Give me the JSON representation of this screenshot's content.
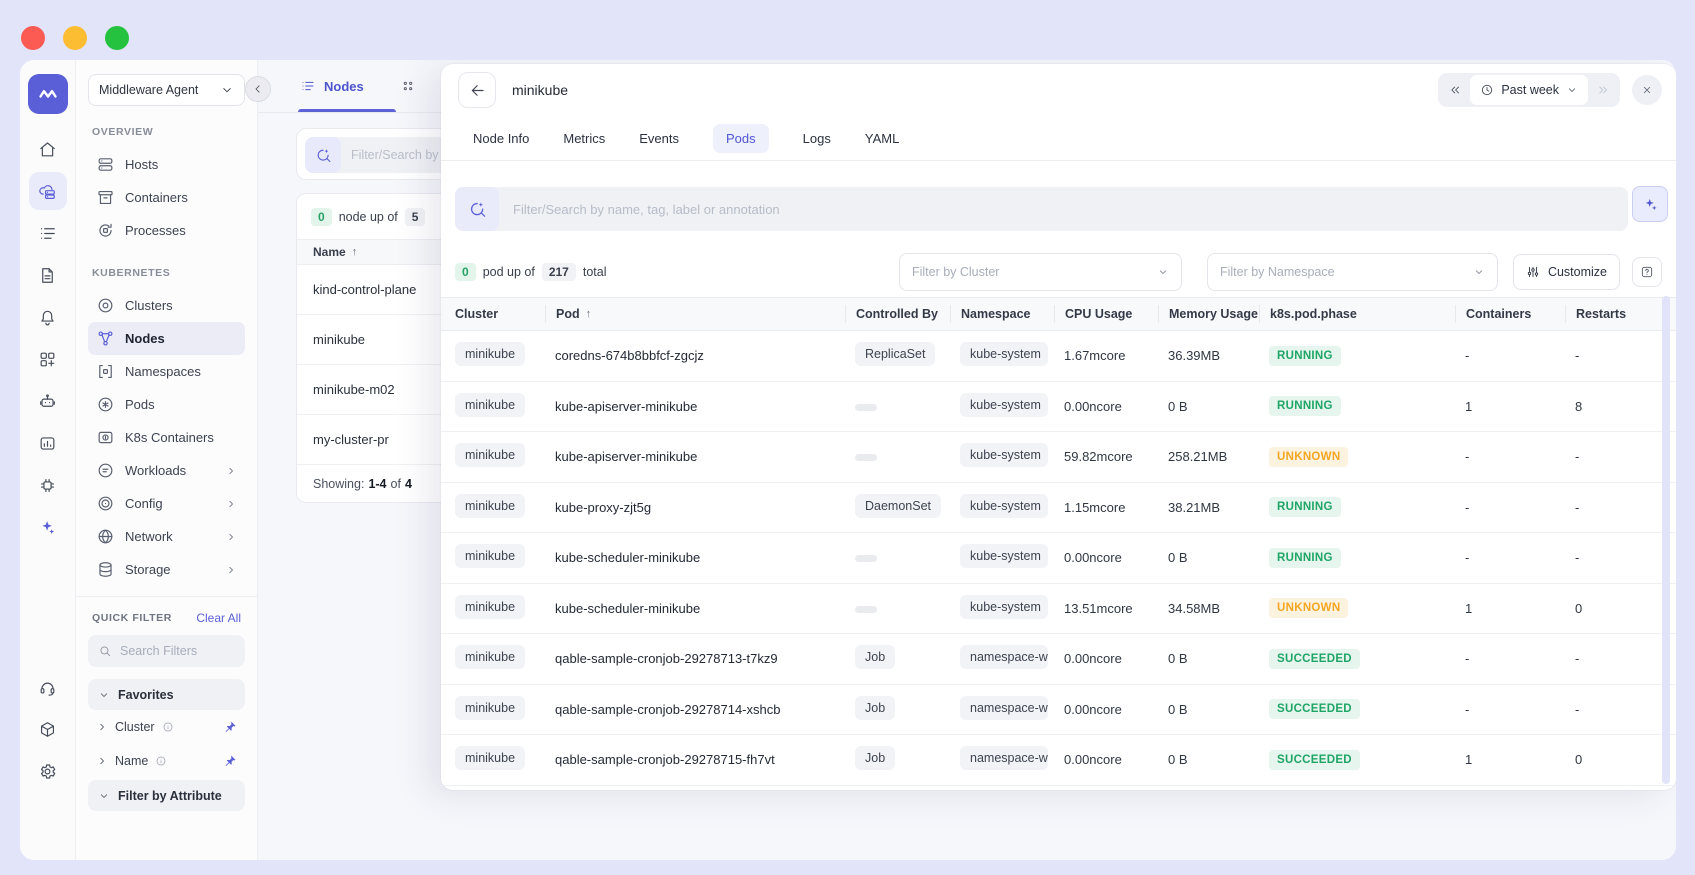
{
  "window": {
    "traffic_lights": [
      "#fc5b54",
      "#fdbd33",
      "#25c23f"
    ]
  },
  "rail": {
    "top": [
      {
        "name": "home",
        "icon": "home"
      },
      {
        "name": "infrastructure",
        "icon": "infra",
        "active": true
      },
      {
        "name": "logs",
        "icon": "list"
      },
      {
        "name": "reports",
        "icon": "document"
      },
      {
        "name": "alerts",
        "icon": "bell"
      },
      {
        "name": "dashboards",
        "icon": "dashboards"
      },
      {
        "name": "ai-agent",
        "icon": "bot"
      },
      {
        "name": "anomaly",
        "icon": "anomaly"
      },
      {
        "name": "resources",
        "icon": "chip"
      },
      {
        "name": "ai-assist",
        "icon": "sparkle",
        "tinted": true
      }
    ],
    "bottom": [
      {
        "name": "support",
        "icon": "headset"
      },
      {
        "name": "integrations",
        "icon": "package"
      },
      {
        "name": "settings",
        "icon": "gear"
      }
    ]
  },
  "sidebar": {
    "workspace": "Middleware Agent",
    "sections": [
      {
        "label": "OVERVIEW",
        "items": [
          {
            "label": "Hosts",
            "icon": "hosts"
          },
          {
            "label": "Containers",
            "icon": "containers"
          },
          {
            "label": "Processes",
            "icon": "processes"
          }
        ]
      },
      {
        "label": "KUBERNETES",
        "items": [
          {
            "label": "Clusters",
            "icon": "clusters"
          },
          {
            "label": "Nodes",
            "icon": "nodes",
            "active": true
          },
          {
            "label": "Namespaces",
            "icon": "namespaces"
          },
          {
            "label": "Pods",
            "icon": "pods"
          },
          {
            "label": "K8s Containers",
            "icon": "k8scont"
          },
          {
            "label": "Workloads",
            "icon": "workloads",
            "expandable": true
          },
          {
            "label": "Config",
            "icon": "config",
            "expandable": true
          },
          {
            "label": "Network",
            "icon": "network",
            "expandable": true
          },
          {
            "label": "Storage",
            "icon": "storage",
            "expandable": true
          }
        ]
      }
    ],
    "quick": {
      "label": "QUICK FILTER",
      "clear": "Clear All",
      "search_placeholder": "Search Filters",
      "favorites": "Favorites",
      "pinned": [
        "Cluster",
        "Name"
      ],
      "attribute": "Filter by Attribute"
    }
  },
  "nodes_panel": {
    "tab": "Nodes",
    "search_placeholder": "Filter/Search by name, tag, label or annotation",
    "count": {
      "up": "0",
      "mid": "node up of",
      "total": "5"
    },
    "column": "Name",
    "sort_arrow": "↑",
    "rows": [
      "kind-control-plane",
      "minikube",
      "minikube-m02",
      "my-cluster-pr"
    ],
    "showing": {
      "prefix": "Showing:",
      "range": "1-4",
      "of": "of",
      "total": "4"
    }
  },
  "drawer": {
    "title": "minikube",
    "time_range": "Past week",
    "tabs": [
      {
        "label": "Node Info"
      },
      {
        "label": "Metrics"
      },
      {
        "label": "Events"
      },
      {
        "label": "Pods",
        "active": true
      },
      {
        "label": "Logs"
      },
      {
        "label": "YAML"
      }
    ],
    "search_placeholder": "Filter/Search by name, tag, label or annotation",
    "summary": {
      "up": "0",
      "mid": "pod up of",
      "total": "217",
      "suffix": "total"
    },
    "filters": {
      "cluster": "Filter by Cluster",
      "namespace": "Filter by Namespace",
      "customize": "Customize"
    },
    "table": {
      "columns": [
        "Cluster",
        "Pod",
        "Controlled By",
        "Namespace",
        "CPU Usage",
        "Memory Usage",
        "k8s.pod.phase",
        "Containers",
        "Restarts"
      ],
      "sorted_column": "Pod",
      "rows": [
        {
          "cluster": "minikube",
          "pod": "coredns-674b8bbfcf-zgcjz",
          "controlled_by": "ReplicaSet",
          "namespace": "kube-system",
          "cpu": "1.67mcore",
          "memory": "36.39MB",
          "phase": "RUNNING",
          "phase_type": "ok",
          "containers": "-",
          "restarts": "-"
        },
        {
          "cluster": "minikube",
          "pod": "kube-apiserver-minikube",
          "controlled_by": "",
          "namespace": "kube-system",
          "cpu": "0.00ncore",
          "memory": "0 B",
          "phase": "RUNNING",
          "phase_type": "ok",
          "containers": "1",
          "restarts": "8"
        },
        {
          "cluster": "minikube",
          "pod": "kube-apiserver-minikube",
          "controlled_by": "",
          "namespace": "kube-system",
          "cpu": "59.82mcore",
          "memory": "258.21MB",
          "phase": "UNKNOWN",
          "phase_type": "warn",
          "containers": "-",
          "restarts": "-"
        },
        {
          "cluster": "minikube",
          "pod": "kube-proxy-zjt5g",
          "controlled_by": "DaemonSet",
          "namespace": "kube-system",
          "cpu": "1.15mcore",
          "memory": "38.21MB",
          "phase": "RUNNING",
          "phase_type": "ok",
          "containers": "-",
          "restarts": "-"
        },
        {
          "cluster": "minikube",
          "pod": "kube-scheduler-minikube",
          "controlled_by": "",
          "namespace": "kube-system",
          "cpu": "0.00ncore",
          "memory": "0 B",
          "phase": "RUNNING",
          "phase_type": "ok",
          "containers": "-",
          "restarts": "-"
        },
        {
          "cluster": "minikube",
          "pod": "kube-scheduler-minikube",
          "controlled_by": "",
          "namespace": "kube-system",
          "cpu": "13.51mcore",
          "memory": "34.58MB",
          "phase": "UNKNOWN",
          "phase_type": "warn",
          "containers": "1",
          "restarts": "0"
        },
        {
          "cluster": "minikube",
          "pod": "qable-sample-cronjob-29278713-t7kz9",
          "controlled_by": "Job",
          "namespace": "namespace-w",
          "cpu": "0.00ncore",
          "memory": "0 B",
          "phase": "SUCCEEDED",
          "phase_type": "ok",
          "containers": "-",
          "restarts": "-"
        },
        {
          "cluster": "minikube",
          "pod": "qable-sample-cronjob-29278714-xshcb",
          "controlled_by": "Job",
          "namespace": "namespace-w",
          "cpu": "0.00ncore",
          "memory": "0 B",
          "phase": "SUCCEEDED",
          "phase_type": "ok",
          "containers": "-",
          "restarts": "-"
        },
        {
          "cluster": "minikube",
          "pod": "qable-sample-cronjob-29278715-fh7vt",
          "controlled_by": "Job",
          "namespace": "namespace-w",
          "cpu": "0.00ncore",
          "memory": "0 B",
          "phase": "SUCCEEDED",
          "phase_type": "ok",
          "containers": "1",
          "restarts": "0"
        }
      ]
    }
  },
  "colors": {
    "accent": "#5a5fd8",
    "green": "#1fa566",
    "green_bg": "#e6f5ee",
    "orange": "#f5a623",
    "orange_bg": "#fcf2e0",
    "page_bg": "#e2e4fa"
  }
}
